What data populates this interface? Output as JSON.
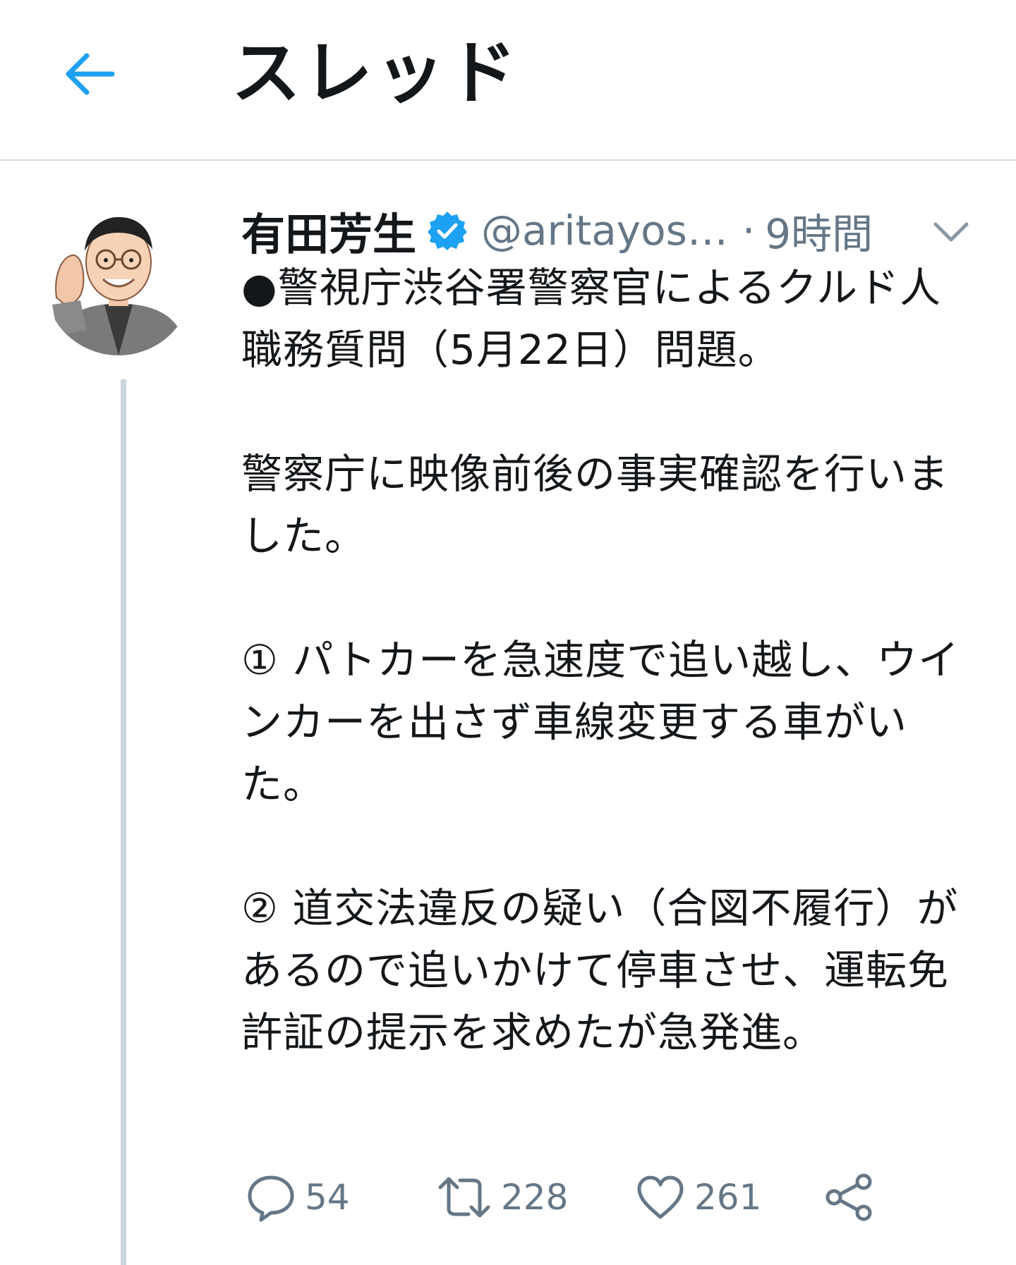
{
  "header": {
    "title": "スレッド",
    "back_icon": "arrow-left-icon",
    "accent": "#1da1f2"
  },
  "tweet": {
    "author": {
      "display_name": "有田芳生",
      "verified_icon": "verified-badge-icon",
      "handle": "@aritayos…",
      "separator": "·",
      "time": "9時間"
    },
    "menu_icon": "chevron-down-icon",
    "paragraphs": [
      "●警視庁渋谷署警察官によるクルド人職務質問（5月22日）問題。",
      "警察庁に映像前後の事実確認を行いました。",
      "① パトカーを急速度で追い越し、ウインカーを出さず車線変更する車がいた。",
      "② 道交法違反の疑い（合図不履行）があるので追いかけて停車させ、運転免許証の提示を求めたが急発進。"
    ],
    "actions": {
      "reply": {
        "icon": "reply-icon",
        "count": "54"
      },
      "retweet": {
        "icon": "retweet-icon",
        "count": "228"
      },
      "like": {
        "icon": "heart-icon",
        "count": "261"
      },
      "share": {
        "icon": "share-icon"
      }
    }
  },
  "colors": {
    "text": "#14171a",
    "secondary": "#657786",
    "divider": "#d7dde2",
    "thread_line": "#ccd6dd",
    "verified": "#1da1f2"
  }
}
